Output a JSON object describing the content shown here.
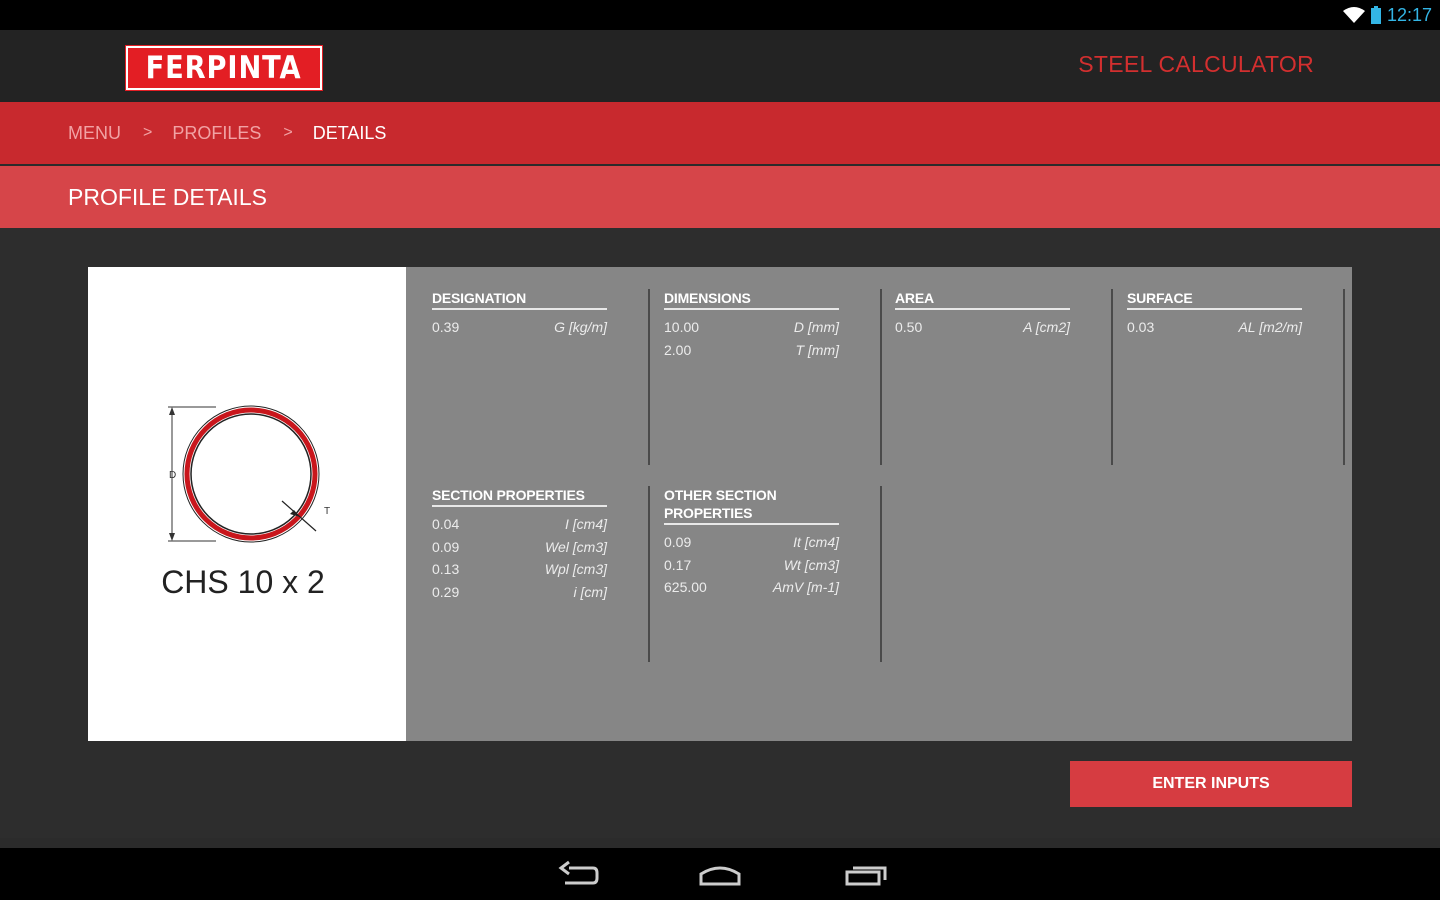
{
  "status_bar": {
    "time": "12:17",
    "icons": [
      "wifi-icon",
      "battery-icon"
    ]
  },
  "header": {
    "logo_text": "FERPINTA",
    "app_title": "STEEL CALCULATOR"
  },
  "breadcrumb": {
    "items": [
      "MENU",
      "PROFILES",
      "DETAILS"
    ],
    "separator": ">"
  },
  "section": {
    "title": "PROFILE DETAILS"
  },
  "profile": {
    "name": "CHS 10 x 2",
    "diameter_label": "D",
    "thickness_label": "T"
  },
  "groups": {
    "designation": {
      "title": "DESIGNATION",
      "rows": [
        {
          "value": "0.39",
          "unit": "G [kg/m]"
        }
      ]
    },
    "dimensions": {
      "title": "DIMENSIONS",
      "rows": [
        {
          "value": "10.00",
          "unit": "D [mm]"
        },
        {
          "value": "2.00",
          "unit": "T [mm]"
        }
      ]
    },
    "area": {
      "title": "AREA",
      "rows": [
        {
          "value": "0.50",
          "unit": "A [cm2]"
        }
      ]
    },
    "surface": {
      "title": "SURFACE",
      "rows": [
        {
          "value": "0.03",
          "unit": "AL [m2/m]"
        }
      ]
    },
    "section_properties": {
      "title": "SECTION PROPERTIES",
      "rows": [
        {
          "value": "0.04",
          "unit": "I [cm4]"
        },
        {
          "value": "0.09",
          "unit": "Wel [cm3]"
        },
        {
          "value": "0.13",
          "unit": "Wpl [cm3]"
        },
        {
          "value": "0.29",
          "unit": "i [cm]"
        }
      ]
    },
    "other_section_properties": {
      "title_line1": "OTHER SECTION",
      "title_line2": "PROPERTIES",
      "rows": [
        {
          "value": "0.09",
          "unit": "It [cm4]"
        },
        {
          "value": "0.17",
          "unit": "Wt [cm3]"
        },
        {
          "value": "625.00",
          "unit": "AmV [m-1]"
        }
      ]
    }
  },
  "actions": {
    "enter_inputs": "ENTER INPUTS"
  },
  "nav_bar": {
    "buttons": [
      "back-icon",
      "home-icon",
      "recents-icon"
    ]
  },
  "colors": {
    "brand_red": "#e31e24",
    "breadcrumb_bg": "#c8292e",
    "section_bg": "#d64549",
    "status_blue": "#33b5e5"
  }
}
